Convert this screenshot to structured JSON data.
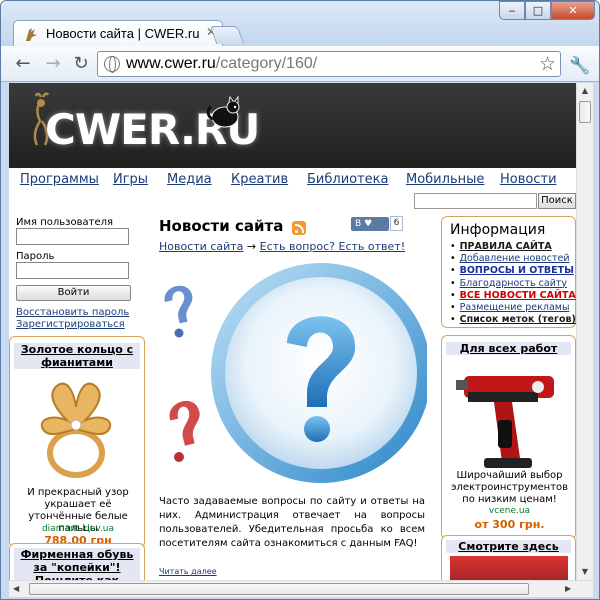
{
  "browser": {
    "tab_title": "Новости сайта | CWER.ru",
    "url_domain": "www.cwer.ru",
    "url_path": "/category/160/",
    "window_buttons": {
      "minimize": "‒",
      "maximize": "□",
      "close": "✕"
    }
  },
  "site": {
    "logo": "CWER.RU",
    "menu": [
      "Программы",
      "Игры",
      "Медиа",
      "Креатив",
      "Библиотека",
      "Мобильные",
      "Новости"
    ],
    "search_button": "Поиск"
  },
  "login": {
    "username_label": "Имя пользователя",
    "password_label": "Пароль",
    "submit": "Войти",
    "restore": "Восстановить пароль",
    "register": "Зарегистрироваться"
  },
  "ads_left": [
    {
      "title": "Золотое кольцо с фианитами",
      "text": "И прекрасный узор украшает её утончённые белые пальцы",
      "site": "diamant.kiev.ua",
      "price": "788.00 грн"
    },
    {
      "title": "Фирменная обувь за \"копейки\"! Пошлите как ширпо"
    }
  ],
  "main": {
    "title": "Новости сайта",
    "share_label": "В",
    "share_count": "6",
    "crumb_1": "Новости сайта",
    "crumb_arrow": "→",
    "crumb_2": "Есть вопрос? Есть ответ!",
    "body": "Часто задаваемые вопросы по сайту и ответы на них. Администрация отвечает на вопросы пользователей. Убедительная просьба ко всем посетителям сайта ознакомиться с данным FAQ!",
    "read_more": "Читать далее"
  },
  "info": {
    "title": "Информация",
    "items": [
      {
        "label": "ПРАВИЛА САЙТА",
        "color": "#1a1a1a",
        "bold": true
      },
      {
        "label": "Добавление новостей",
        "color": "#1a3c78",
        "bold": false
      },
      {
        "label": "ВОПРОСЫ И ОТВЕТЫ",
        "color": "#1c2f9c",
        "bold": true
      },
      {
        "label": "Благодарность сайту",
        "color": "#1a3c78",
        "bold": false
      },
      {
        "label": "ВСЕ НОВОСТИ САЙТА",
        "color": "#d10000",
        "bold": true
      },
      {
        "label": "Размещение рекламы",
        "color": "#1a3c78",
        "bold": false
      },
      {
        "label": "Список меток (тегов)",
        "color": "#1a1a1a",
        "bold": true
      }
    ]
  },
  "ads_right": [
    {
      "title": "Для всех работ",
      "text": "Широчайший выбор электроинструментов по низким ценам!",
      "site": "vcene.ua",
      "price": "от 300 грн."
    },
    {
      "title": "Смотрите здесь"
    }
  ]
}
